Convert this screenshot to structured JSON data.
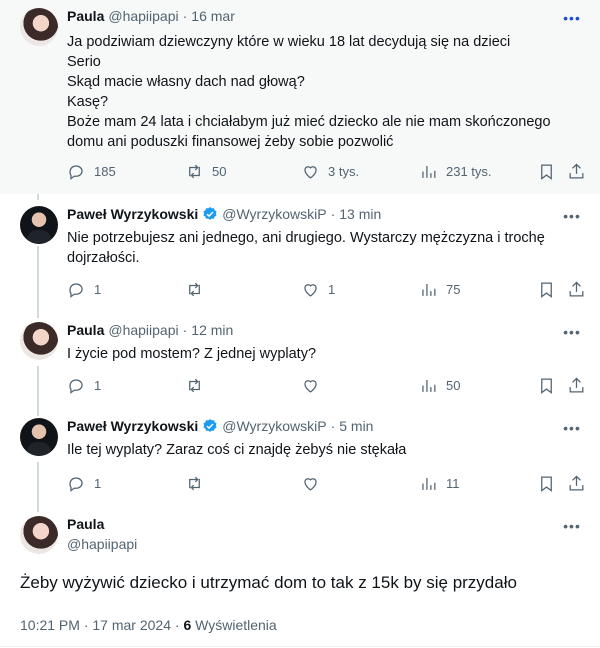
{
  "tweets": [
    {
      "name": "Paula",
      "handle": "@hapiipapi",
      "dot": "·",
      "time": "16 mar",
      "lines": [
        "Ja podziwiam dziewczyny które w wieku 18 lat decydują się na dzieci",
        "Serio",
        "Skąd macie własny dach nad głową?",
        "Kasę?",
        "Boże mam 24 lata i chciałabym już mieć dziecko ale nie mam skończonego",
        "domu ani poduszki finansowej żeby sobie pozwolić"
      ],
      "replies": "185",
      "retweets": "50",
      "likes": "3 tys.",
      "views": "231 tys."
    },
    {
      "name": "Paweł Wyrzykowski",
      "handle": "@WyrzykowskiP",
      "dot": "·",
      "time": "13 min",
      "lines": [
        "Nie potrzebujesz ani jednego, ani drugiego. Wystarczy mężczyzna i trochę",
        "dojrzałości."
      ],
      "replies": "1",
      "retweets": "",
      "likes": "1",
      "views": "75"
    },
    {
      "name": "Paula",
      "handle": "@hapiipapi",
      "dot": "·",
      "time": "12 min",
      "lines": [
        "I życie pod mostem? Z jednej wyplaty?"
      ],
      "replies": "1",
      "retweets": "",
      "likes": "",
      "views": "50"
    },
    {
      "name": "Paweł Wyrzykowski",
      "handle": "@WyrzykowskiP",
      "dot": "·",
      "time": "5 min",
      "lines": [
        "Ile tej wyplaty? Zaraz coś ci znajdę żebyś nie stękała"
      ],
      "replies": "1",
      "retweets": "",
      "likes": "",
      "views": "11"
    }
  ],
  "main": {
    "name": "Paula",
    "handle": "@hapiipapi",
    "text": "Żeby wyżywić dziecko i utrzymać dom to tak z 15k by się przydało",
    "time": "10:21 PM",
    "dot1": "·",
    "date": "17 mar 2024",
    "dot2": "·",
    "views_count": "6",
    "views_label": "Wyświetlenia"
  },
  "icons": {
    "more": "more-icon",
    "reply": "reply-icon",
    "retweet": "retweet-icon",
    "like": "heart-icon",
    "views": "views-icon",
    "bookmark": "bookmark-icon",
    "share": "share-icon",
    "verified": "verified-badge-icon"
  },
  "colors": {
    "verified_blue": "#1d9bf0",
    "text": "#0f1419",
    "secondary": "#536471",
    "highlight_bg": "#f7f9f9"
  }
}
